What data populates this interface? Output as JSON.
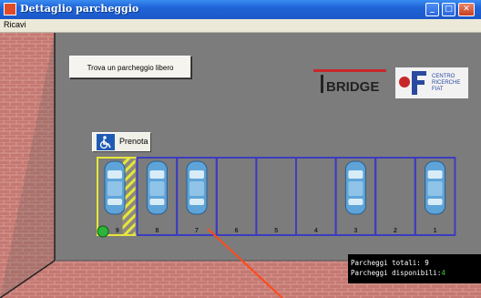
{
  "window": {
    "title": "Dettaglio parcheggio",
    "buttons": [
      "minimize",
      "maximize",
      "close"
    ]
  },
  "menu": {
    "items": [
      "Ricavi"
    ]
  },
  "actions": {
    "find_free": "Trova un parcheggio libero"
  },
  "logos": {
    "bridge_text": "BRIDGE",
    "crf_lines": [
      "CENTRO",
      "RICERCHE",
      "FIAT"
    ]
  },
  "reservation": {
    "button_label": "Prenota",
    "icon": "wheelchair-icon"
  },
  "parking": {
    "slots": [
      {
        "number": "9",
        "occupied": true,
        "handicap": true,
        "selected": true
      },
      {
        "number": "8",
        "occupied": true
      },
      {
        "number": "7",
        "occupied": true
      },
      {
        "number": "6",
        "occupied": false
      },
      {
        "number": "5",
        "occupied": false
      },
      {
        "number": "4",
        "occupied": false
      },
      {
        "number": "3",
        "occupied": true
      },
      {
        "number": "2",
        "occupied": false
      },
      {
        "number": "1",
        "occupied": true
      }
    ]
  },
  "status": {
    "total_label": "Parcheggi totali:",
    "total_value": "9",
    "available_label": "Parcheggi disponibili:",
    "available_value": "4"
  },
  "colors": {
    "slot_line": "#3c3cc0",
    "selected_line": "#e6e63a",
    "ground": "#7c7c7c",
    "brick": "#c47872",
    "marker": "#2ab53a",
    "pointer": "#ff4a1a"
  }
}
